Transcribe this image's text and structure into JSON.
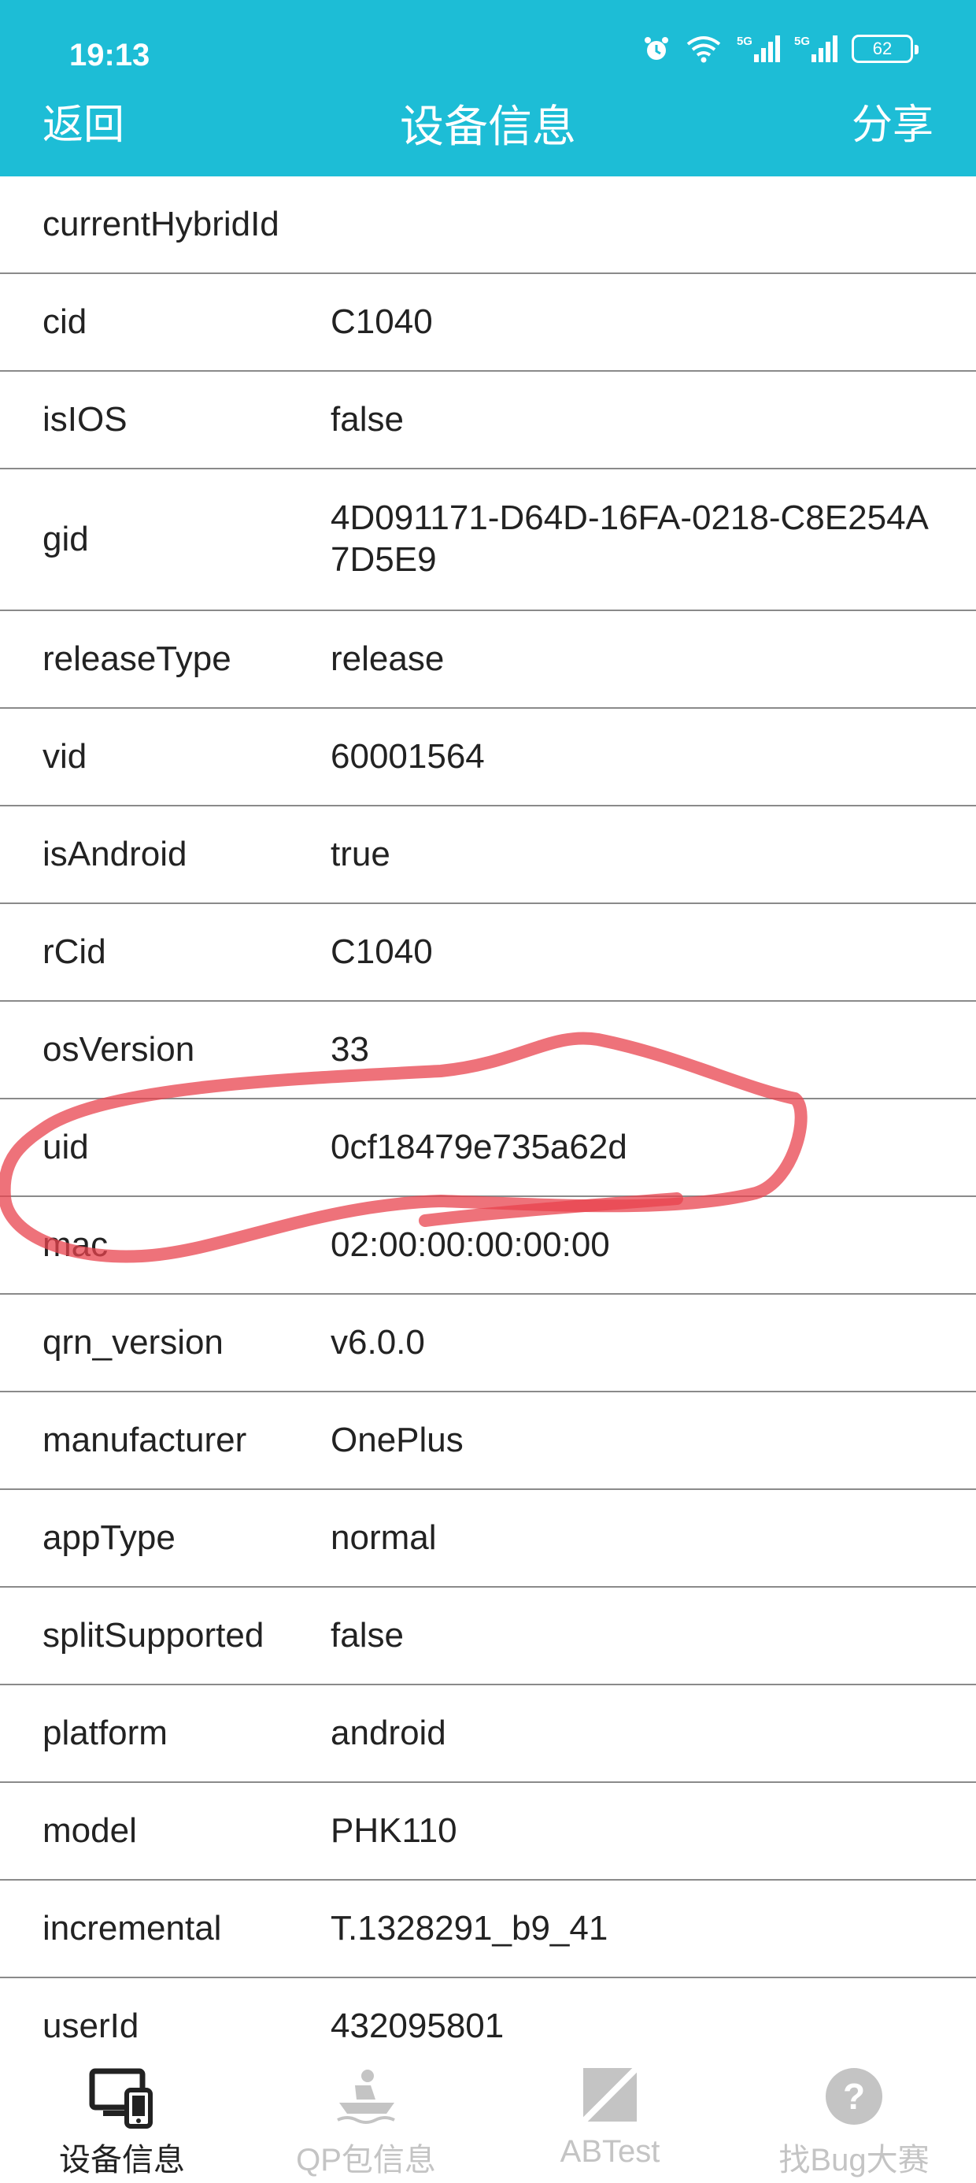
{
  "status": {
    "time": "19:13",
    "network1": "5G",
    "network2": "5G",
    "battery": "62"
  },
  "nav": {
    "back": "返回",
    "title": "设备信息",
    "share": "分享"
  },
  "rows": [
    {
      "key": "currentHybridId",
      "value": ""
    },
    {
      "key": "cid",
      "value": "C1040"
    },
    {
      "key": "isIOS",
      "value": "false"
    },
    {
      "key": "gid",
      "value": "4D091171-D64D-16FA-0218-C8E254A7D5E9"
    },
    {
      "key": "releaseType",
      "value": "release"
    },
    {
      "key": "vid",
      "value": "60001564"
    },
    {
      "key": "isAndroid",
      "value": "true"
    },
    {
      "key": "rCid",
      "value": "C1040"
    },
    {
      "key": "osVersion",
      "value": "33"
    },
    {
      "key": "uid",
      "value": "0cf18479e735a62d"
    },
    {
      "key": "mac",
      "value": "02:00:00:00:00:00"
    },
    {
      "key": "qrn_version",
      "value": "v6.0.0"
    },
    {
      "key": "manufacturer",
      "value": "OnePlus"
    },
    {
      "key": "appType",
      "value": "normal"
    },
    {
      "key": "splitSupported",
      "value": "false"
    },
    {
      "key": "platform",
      "value": "android"
    },
    {
      "key": "model",
      "value": "PHK110"
    },
    {
      "key": "incremental",
      "value": "T.1328291_b9_41"
    },
    {
      "key": "userId",
      "value": "432095801"
    }
  ],
  "tabs": [
    {
      "label": "设备信息",
      "icon": "device-icon",
      "active": true
    },
    {
      "label": "QP包信息",
      "icon": "boat-icon",
      "active": false
    },
    {
      "label": "ABTest",
      "icon": "abtest-icon",
      "active": false
    },
    {
      "label": "找Bug大赛",
      "icon": "question-icon",
      "active": false
    }
  ],
  "colors": {
    "header": "#1dbdd6",
    "annotation": "#e8434e"
  }
}
